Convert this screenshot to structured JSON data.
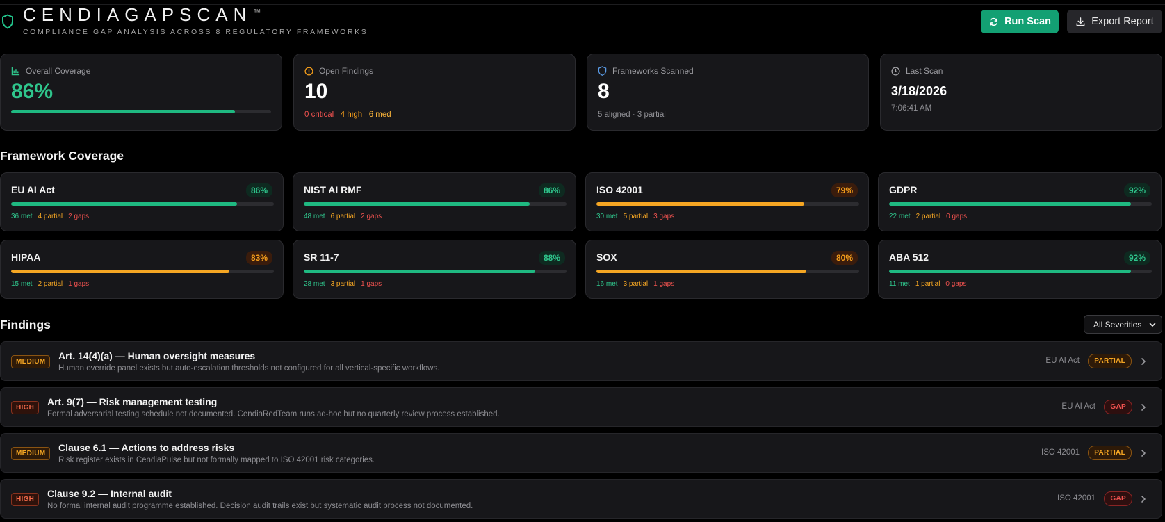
{
  "header": {
    "brand": "CENDIAGAPSCAN",
    "trademark": "™",
    "subtitle": "COMPLIANCE GAP ANALYSIS ACROSS 8 REGULATORY FRAMEWORKS",
    "run_scan_label": "Run Scan",
    "export_label": "Export Report"
  },
  "stats": {
    "coverage": {
      "label": "Overall Coverage",
      "value": "86%",
      "progress": 0.86
    },
    "findings": {
      "label": "Open Findings",
      "value": "10",
      "critical": "0 critical",
      "high": "4 high",
      "med": "6 med"
    },
    "frameworks": {
      "label": "Frameworks Scanned",
      "value": "8",
      "detail": "5 aligned · 3 partial"
    },
    "last_scan": {
      "label": "Last Scan",
      "date": "3/18/2026",
      "time": "7:06:41 AM"
    }
  },
  "framework_section_title": "Framework Coverage",
  "frameworks": [
    {
      "name": "EU AI Act",
      "pct": "86%",
      "progress": 0.86,
      "status": "good",
      "met": "36 met",
      "partial": "4 partial",
      "gaps": "2 gaps"
    },
    {
      "name": "NIST AI RMF",
      "pct": "86%",
      "progress": 0.86,
      "status": "good",
      "met": "48 met",
      "partial": "6 partial",
      "gaps": "2 gaps"
    },
    {
      "name": "ISO 42001",
      "pct": "79%",
      "progress": 0.79,
      "status": "warn",
      "met": "30 met",
      "partial": "5 partial",
      "gaps": "3 gaps"
    },
    {
      "name": "GDPR",
      "pct": "92%",
      "progress": 0.92,
      "status": "good",
      "met": "22 met",
      "partial": "2 partial",
      "gaps": "0 gaps"
    },
    {
      "name": "HIPAA",
      "pct": "83%",
      "progress": 0.83,
      "status": "warn",
      "met": "15 met",
      "partial": "2 partial",
      "gaps": "1 gaps"
    },
    {
      "name": "SR 11-7",
      "pct": "88%",
      "progress": 0.88,
      "status": "good",
      "met": "28 met",
      "partial": "3 partial",
      "gaps": "1 gaps"
    },
    {
      "name": "SOX",
      "pct": "80%",
      "progress": 0.8,
      "status": "warn",
      "met": "16 met",
      "partial": "3 partial",
      "gaps": "1 gaps"
    },
    {
      "name": "ABA 512",
      "pct": "92%",
      "progress": 0.92,
      "status": "good",
      "met": "11 met",
      "partial": "1 partial",
      "gaps": "0 gaps"
    }
  ],
  "findings_section_title": "Findings",
  "severity_filter": {
    "selected": "All Severities"
  },
  "findings": [
    {
      "severity": "MEDIUM",
      "sev_class": "medium",
      "title": "Art. 14(4)(a) — Human oversight measures",
      "description": "Human override panel exists but auto-escalation thresholds not configured for all vertical-specific workflows.",
      "framework": "EU AI Act",
      "status": "PARTIAL",
      "status_class": "partial"
    },
    {
      "severity": "HIGH",
      "sev_class": "high",
      "title": "Art. 9(7) — Risk management testing",
      "description": "Formal adversarial testing schedule not documented. CendiaRedTeam runs ad-hoc but no quarterly review process established.",
      "framework": "EU AI Act",
      "status": "GAP",
      "status_class": "gap"
    },
    {
      "severity": "MEDIUM",
      "sev_class": "medium",
      "title": "Clause 6.1 — Actions to address risks",
      "description": "Risk register exists in CendiaPulse but not formally mapped to ISO 42001 risk categories.",
      "framework": "ISO 42001",
      "status": "PARTIAL",
      "status_class": "partial"
    },
    {
      "severity": "HIGH",
      "sev_class": "high",
      "title": "Clause 9.2 — Internal audit",
      "description": "No formal internal audit programme established. Decision audit trails exist but systematic audit process not documented.",
      "framework": "ISO 42001",
      "status": "GAP",
      "status_class": "gap"
    }
  ]
}
